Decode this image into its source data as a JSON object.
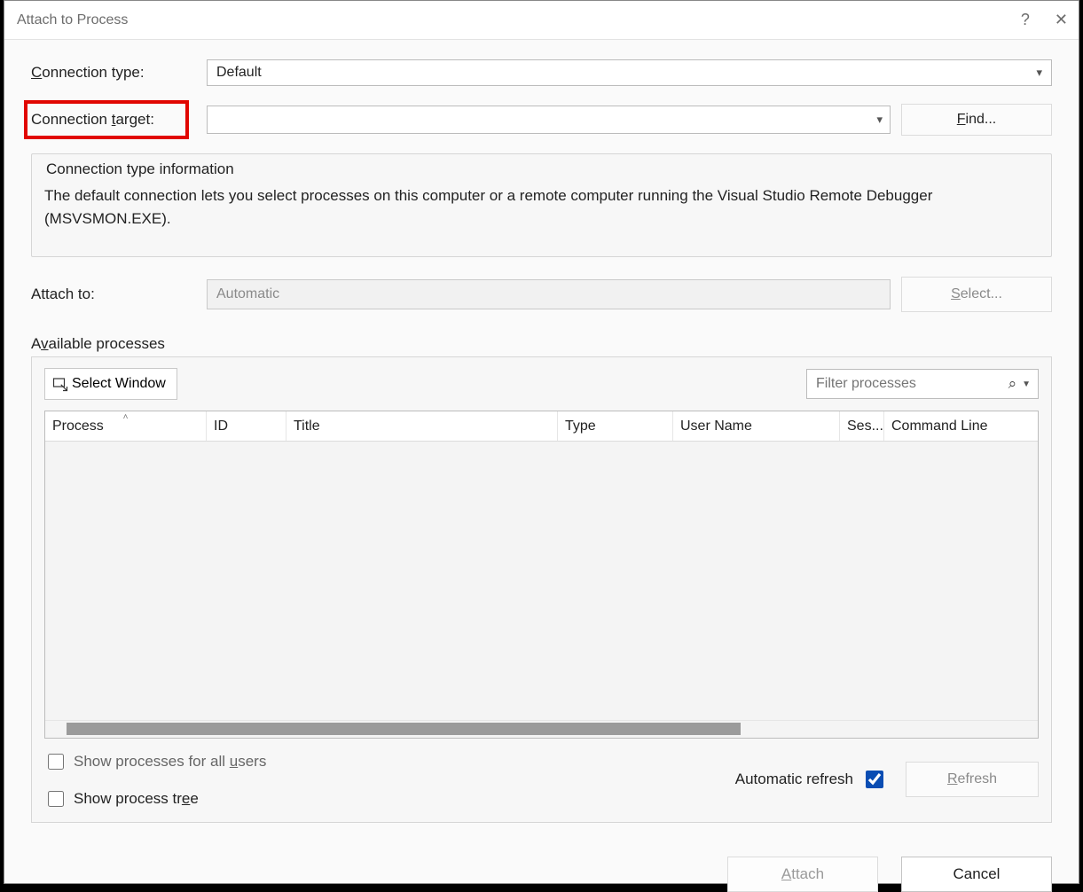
{
  "window": {
    "title": "Attach to Process",
    "help_icon": "?",
    "close_icon": "✕"
  },
  "labels": {
    "connection_type": "Connection type:",
    "connection_target": "Connection target:",
    "attach_to": "Attach to:",
    "available_processes": "Available processes",
    "automatic_refresh": "Automatic refresh",
    "show_all_users": "Show processes for all users",
    "show_tree": "Show process tree"
  },
  "values": {
    "connection_type": "Default",
    "connection_target": "",
    "attach_to": "Automatic",
    "filter_placeholder": "Filter processes"
  },
  "buttons": {
    "find": "Find...",
    "select": "Select...",
    "select_window": "Select Window",
    "refresh": "Refresh",
    "attach": "Attach",
    "cancel": "Cancel"
  },
  "info": {
    "legend": "Connection type information",
    "text": "The default connection lets you select processes on this computer or a remote computer running the Visual Studio Remote Debugger (MSVSMON.EXE)."
  },
  "table": {
    "columns": [
      "Process",
      "ID",
      "Title",
      "Type",
      "User Name",
      "Ses...",
      "Command Line"
    ],
    "rows": []
  },
  "checks": {
    "show_all_users": false,
    "show_tree": false,
    "automatic_refresh": true
  }
}
